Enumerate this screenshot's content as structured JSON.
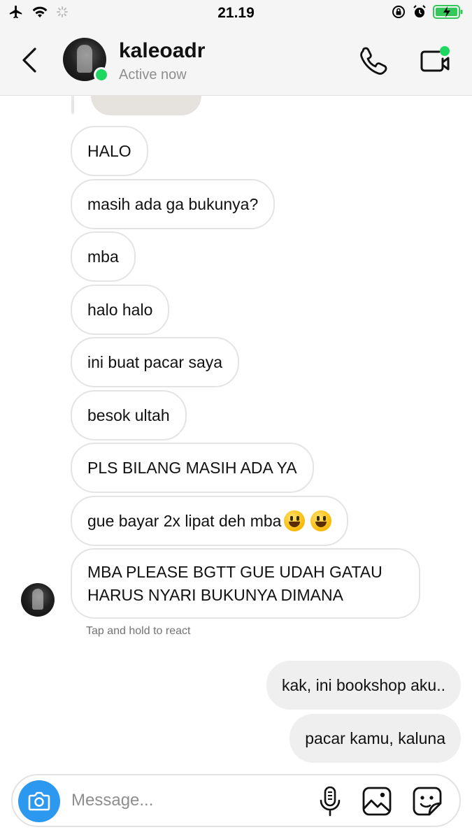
{
  "status_bar": {
    "time": "21.19",
    "left_icons": [
      "airplane-icon",
      "wifi-icon",
      "loading-icon"
    ],
    "right_icons": [
      "orientation-lock-icon",
      "alarm-icon",
      "battery-charging-icon"
    ]
  },
  "header": {
    "username": "kaleoadr",
    "status": "Active now",
    "icons": [
      "back-icon",
      "phone-icon",
      "video-call-icon"
    ]
  },
  "messages": [
    {
      "from": "them",
      "text": "HALO"
    },
    {
      "from": "them",
      "text": "masih ada ga bukunya?"
    },
    {
      "from": "them",
      "text": "mba"
    },
    {
      "from": "them",
      "text": "halo halo"
    },
    {
      "from": "them",
      "text": "ini buat pacar saya"
    },
    {
      "from": "them",
      "text": "besok ultah"
    },
    {
      "from": "them",
      "text": "PLS BILANG MASIH ADA YA"
    },
    {
      "from": "them",
      "text": "gue bayar 2x lipat deh mba",
      "emoji_count": 2
    },
    {
      "from": "them",
      "text": "MBA PLEASE BGTT GUE UDAH GATAU HARUS NYARI BUKUNYA DIMANA"
    },
    {
      "from": "me",
      "text": "kak, ini bookshop aku.."
    },
    {
      "from": "me",
      "text": "pacar kamu, kaluna"
    }
  ],
  "react_hint": "Tap and hold to react",
  "composer": {
    "placeholder": "Message...",
    "icons": [
      "camera-icon",
      "microphone-icon",
      "gallery-icon",
      "sticker-icon"
    ]
  },
  "colors": {
    "online": "#1ed760",
    "camera_button": "#2c98f0",
    "outgoing_bubble": "#efefef",
    "incoming_border": "#e4e4e4"
  }
}
